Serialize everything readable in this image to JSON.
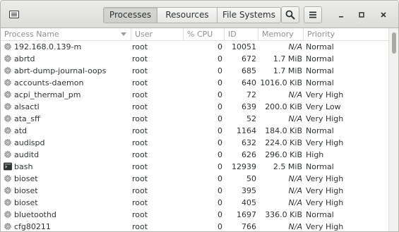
{
  "header": {
    "app_menu_icon": "system-monitor-icon",
    "tabs": [
      {
        "label": "Processes",
        "active": true
      },
      {
        "label": "Resources",
        "active": false
      },
      {
        "label": "File Systems",
        "active": false
      }
    ],
    "search_icon": "search-icon",
    "menu_icon": "hamburger-menu-icon",
    "window_controls": [
      "minimize-icon",
      "maximize-icon",
      "close-icon"
    ]
  },
  "columns": {
    "name": "Process Name",
    "user": "User",
    "cpu": "% CPU",
    "id": "ID",
    "memory": "Memory",
    "priority": "Priority"
  },
  "processes": [
    {
      "name": "192.168.0.139-m",
      "icon": "gear-icon",
      "user": "root",
      "cpu": "0",
      "id": "10051",
      "memory": "N/A",
      "priority": "Normal"
    },
    {
      "name": "abrtd",
      "icon": "gear-icon",
      "user": "root",
      "cpu": "0",
      "id": "672",
      "memory": "1.7 MiB",
      "priority": "Normal"
    },
    {
      "name": "abrt-dump-journal-oops",
      "icon": "gear-icon",
      "user": "root",
      "cpu": "0",
      "id": "685",
      "memory": "1.7 MiB",
      "priority": "Normal"
    },
    {
      "name": "accounts-daemon",
      "icon": "gear-icon",
      "user": "root",
      "cpu": "0",
      "id": "640",
      "memory": "1016.0 KiB",
      "priority": "Normal"
    },
    {
      "name": "acpi_thermal_pm",
      "icon": "gear-icon",
      "user": "root",
      "cpu": "0",
      "id": "72",
      "memory": "N/A",
      "priority": "Very High"
    },
    {
      "name": "alsactl",
      "icon": "gear-icon",
      "user": "root",
      "cpu": "0",
      "id": "639",
      "memory": "200.0 KiB",
      "priority": "Very Low"
    },
    {
      "name": "ata_sff",
      "icon": "gear-icon",
      "user": "root",
      "cpu": "0",
      "id": "52",
      "memory": "N/A",
      "priority": "Very High"
    },
    {
      "name": "atd",
      "icon": "gear-icon",
      "user": "root",
      "cpu": "0",
      "id": "1164",
      "memory": "184.0 KiB",
      "priority": "Normal"
    },
    {
      "name": "audispd",
      "icon": "gear-icon",
      "user": "root",
      "cpu": "0",
      "id": "632",
      "memory": "224.0 KiB",
      "priority": "Very High"
    },
    {
      "name": "auditd",
      "icon": "gear-icon",
      "user": "root",
      "cpu": "0",
      "id": "626",
      "memory": "296.0 KiB",
      "priority": "High"
    },
    {
      "name": "bash",
      "icon": "terminal-icon",
      "user": "root",
      "cpu": "0",
      "id": "12939",
      "memory": "2.5 MiB",
      "priority": "Normal"
    },
    {
      "name": "bioset",
      "icon": "gear-icon",
      "user": "root",
      "cpu": "0",
      "id": "50",
      "memory": "N/A",
      "priority": "Very High"
    },
    {
      "name": "bioset",
      "icon": "gear-icon",
      "user": "root",
      "cpu": "0",
      "id": "395",
      "memory": "N/A",
      "priority": "Very High"
    },
    {
      "name": "bioset",
      "icon": "gear-icon",
      "user": "root",
      "cpu": "0",
      "id": "405",
      "memory": "N/A",
      "priority": "Very High"
    },
    {
      "name": "bluetoothd",
      "icon": "gear-icon",
      "user": "root",
      "cpu": "0",
      "id": "1697",
      "memory": "336.0 KiB",
      "priority": "Normal"
    },
    {
      "name": "cfg80211",
      "icon": "gear-icon",
      "user": "root",
      "cpu": "0",
      "id": "766",
      "memory": "N/A",
      "priority": "Very High"
    }
  ]
}
